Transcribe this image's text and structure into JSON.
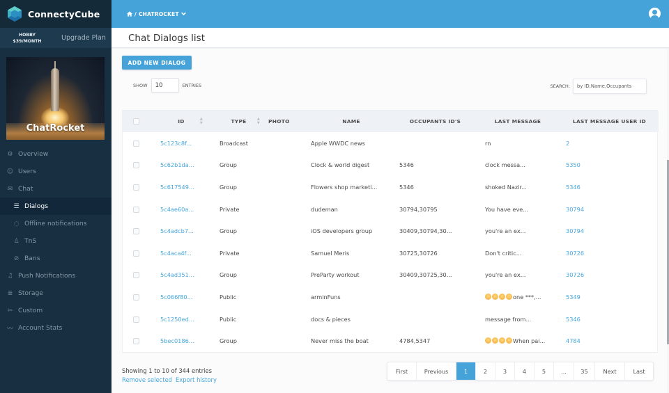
{
  "brand": {
    "name": "ConnectyCube"
  },
  "plan": {
    "tier": "HOBBY",
    "price": "$39/MONTH",
    "upgrade_label": "Upgrade Plan"
  },
  "app": {
    "name": "ChatRocket"
  },
  "sidebar": {
    "items": [
      {
        "label": "Overview",
        "icon": "gear-icon",
        "glyph": "⚙",
        "sub": false,
        "active": false
      },
      {
        "label": "Users",
        "icon": "user-icon",
        "glyph": "☺",
        "sub": false,
        "active": false
      },
      {
        "label": "Chat",
        "icon": "chat-icon",
        "glyph": "✉",
        "sub": false,
        "active": false
      },
      {
        "label": "Dialogs",
        "icon": "list-icon",
        "glyph": "☰",
        "sub": true,
        "active": true
      },
      {
        "label": "Offline notifications",
        "icon": "speech-bubble-icon",
        "glyph": "◌",
        "sub": true,
        "active": false
      },
      {
        "label": "TnS",
        "icon": "person-icon",
        "glyph": "♙",
        "sub": true,
        "active": false
      },
      {
        "label": "Bans",
        "icon": "ban-icon",
        "glyph": "⊘",
        "sub": true,
        "active": false
      },
      {
        "label": "Push Notifications",
        "icon": "bell-icon",
        "glyph": "♫",
        "sub": false,
        "active": false
      },
      {
        "label": "Storage",
        "icon": "database-icon",
        "glyph": "≣",
        "sub": false,
        "active": false
      },
      {
        "label": "Custom",
        "icon": "custom-icon",
        "glyph": "✂",
        "sub": false,
        "active": false
      },
      {
        "label": "Account Stats",
        "icon": "stats-icon",
        "glyph": "〰",
        "sub": false,
        "active": false
      }
    ]
  },
  "header": {
    "breadcrumb_app": "CHATROCKET"
  },
  "page": {
    "title": "Chat Dialogs list"
  },
  "toolbar": {
    "add_label": "ADD NEW DIALOG",
    "show_label": "SHOW",
    "show_value": "10",
    "entries_label": "ENTRIES",
    "search_label": "SEARCH:",
    "search_placeholder": "by ID,Name,Occupants"
  },
  "table": {
    "columns": [
      "ID",
      "TYPE",
      "PHOTO",
      "NAME",
      "OCCUPANTS ID'S",
      "LAST MESSAGE",
      "LAST MESSAGE USER ID"
    ],
    "rows": [
      {
        "id": "5c123c8f...",
        "type": "Broadcast",
        "name": "Apple WWDC news",
        "occupants": "",
        "last_message": "rn",
        "emoji": false,
        "user_id": "2"
      },
      {
        "id": "5c62b1da...",
        "type": "Group",
        "name": "Clock & world digest",
        "occupants": "5346",
        "last_message": "clock messa...",
        "emoji": false,
        "user_id": "5350"
      },
      {
        "id": "5c617549...",
        "type": "Group",
        "name": "Flowers shop marketi...",
        "occupants": "5346",
        "last_message": "shoked Nazir...",
        "emoji": false,
        "user_id": "5346"
      },
      {
        "id": "5c4ae60a...",
        "type": "Private",
        "name": "dudeman",
        "occupants": "30794,30795",
        "last_message": "You have eve...",
        "emoji": false,
        "user_id": "30794"
      },
      {
        "id": "5c4adcb7...",
        "type": "Group",
        "name": "iOS developers group",
        "occupants": "30409,30794,30...",
        "last_message": "you're an ex...",
        "emoji": false,
        "user_id": "30794"
      },
      {
        "id": "5c4aca4f...",
        "type": "Private",
        "name": "Samuel Meris",
        "occupants": "30725,30726",
        "last_message": "Don't critic...",
        "emoji": false,
        "user_id": "30726"
      },
      {
        "id": "5c4ad351...",
        "type": "Group",
        "name": "PreParty workout",
        "occupants": "30409,30725,30...",
        "last_message": "you're an ex...",
        "emoji": false,
        "user_id": "30726"
      },
      {
        "id": "5c066f80...",
        "type": "Public",
        "name": "arminFuns",
        "occupants": "",
        "last_message": "one ***,...",
        "emoji": true,
        "user_id": "5349"
      },
      {
        "id": "5c1250ed...",
        "type": "Public",
        "name": "docs & pieces",
        "occupants": "",
        "last_message": "message from...",
        "emoji": false,
        "user_id": "5346"
      },
      {
        "id": "5bec0186...",
        "type": "Group",
        "name": "Never miss the boat",
        "occupants": "4784,5347",
        "last_message": "When pai...",
        "emoji": true,
        "user_id": "4784"
      }
    ]
  },
  "footer": {
    "summary": "Showing 1 to 10 of 344 entries",
    "remove_label": "Remove selected",
    "export_label": "Export history"
  },
  "pagination": {
    "items": [
      {
        "label": "First",
        "active": false
      },
      {
        "label": "Previous",
        "active": false
      },
      {
        "label": "1",
        "active": true
      },
      {
        "label": "2",
        "active": false
      },
      {
        "label": "3",
        "active": false
      },
      {
        "label": "4",
        "active": false
      },
      {
        "label": "5",
        "active": false
      },
      {
        "label": "...",
        "active": false
      },
      {
        "label": "35",
        "active": false
      },
      {
        "label": "Next",
        "active": false
      },
      {
        "label": "Last",
        "active": false
      }
    ]
  },
  "colors": {
    "accent": "#45a3d9",
    "link": "#46a7de",
    "sidebar_bg": "#172f40"
  }
}
